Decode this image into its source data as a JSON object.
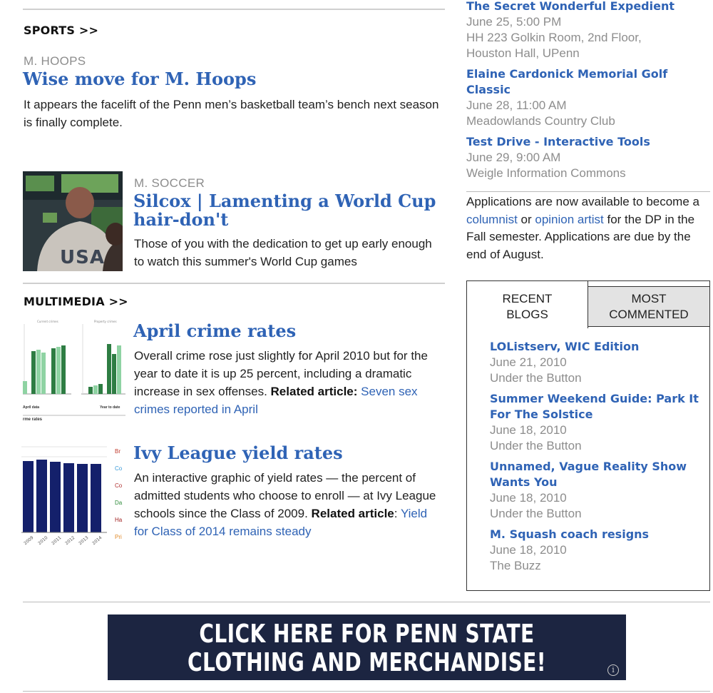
{
  "sports": {
    "section_label": "SPORTS >>",
    "story1": {
      "kicker": "M. HOOPS",
      "headline": "Wise move for M. Hoops",
      "body": "It appears the facelift of the Penn men’s basketball team’s bench next season is finally complete."
    },
    "story2": {
      "kicker": "M. SOCCER",
      "headline": "Silcox | Lamenting a World Cup hair-don't",
      "body": "Those of you with the dedication to get up early enough to watch this summer's World Cup games",
      "thumb_text": "USA"
    }
  },
  "multimedia": {
    "section_label": "MULTIMEDIA >>",
    "item1": {
      "headline": "April crime rates",
      "body": "Overall crime rose just slightly for April 2010 but for the year to date it is up 25 percent, including a dramatic increase in sex offenses.",
      "related_label": "Related article:",
      "related_link": "Seven sex crimes reported in April"
    },
    "item2": {
      "headline": "Ivy League yield rates",
      "body": "An interactive graphic of yield rates — the percent of admitted students who choose to enroll — at Ivy League schools since the Class of 2009.",
      "related_label": "Related article",
      "related_colon": ":",
      "related_link": "Yield for Class of 2014 remains steady"
    }
  },
  "events": [
    {
      "title": "The Secret Wonderful Expedient",
      "date": "June 25, 5:00 PM",
      "location": "HH 223 Golkin Room, 2nd Floor, Houston Hall, UPenn"
    },
    {
      "title": "Elaine Cardonick Memorial Golf Classic",
      "date": "June 28, 11:00 AM",
      "location": "Meadowlands Country Club"
    },
    {
      "title": "Test Drive - Interactive Tools",
      "date": "June 29, 9:00 AM",
      "location": "Weigle Information Commons"
    }
  ],
  "promo": {
    "part1": "Applications are now available to become a ",
    "link1": "columnist",
    "part2": " or ",
    "link2": "opinion artist",
    "part3": " for the DP in the Fall semester. Applications are due by the end of August."
  },
  "tabs": {
    "recent_line1": "RECENT",
    "recent_line2": "BLOGS",
    "most_line1": "MOST",
    "most_line2": "COMMENTED"
  },
  "blogs": [
    {
      "title": "LOListserv, WIC Edition",
      "date": "June 21, 2010",
      "blog": "Under the Button"
    },
    {
      "title": "Summer Weekend Guide: Park It For The Solstice",
      "date": "June 18, 2010",
      "blog": "Under the Button"
    },
    {
      "title": "Unnamed, Vague Reality Show Wants You",
      "date": "June 18, 2010",
      "blog": "Under the Button"
    },
    {
      "title": "M. Squash coach resigns",
      "date": "June 18, 2010",
      "blog": "The Buzz"
    }
  ],
  "banner": {
    "line1": "CLICK HERE FOR PENN STATE",
    "line2": "CLOTHING AND MERCHANDISE!",
    "info_icon_glyph": "i"
  },
  "thumb_crime": {
    "caption_left": "April data",
    "caption_right": "Year to date",
    "caption_bottom": "rme rates"
  },
  "thumb_yield": {
    "legend": [
      "Br",
      "Co",
      "Co",
      "Da",
      "Ha",
      "Pri"
    ]
  },
  "colors": {
    "link_blue": "#2f63b5",
    "meta_gray": "#8d8d8d",
    "banner_bg": "#1c2541",
    "yield_bar": "#14206b",
    "crime_dark": "#2e7d43",
    "crime_light": "#8fd3a3"
  }
}
